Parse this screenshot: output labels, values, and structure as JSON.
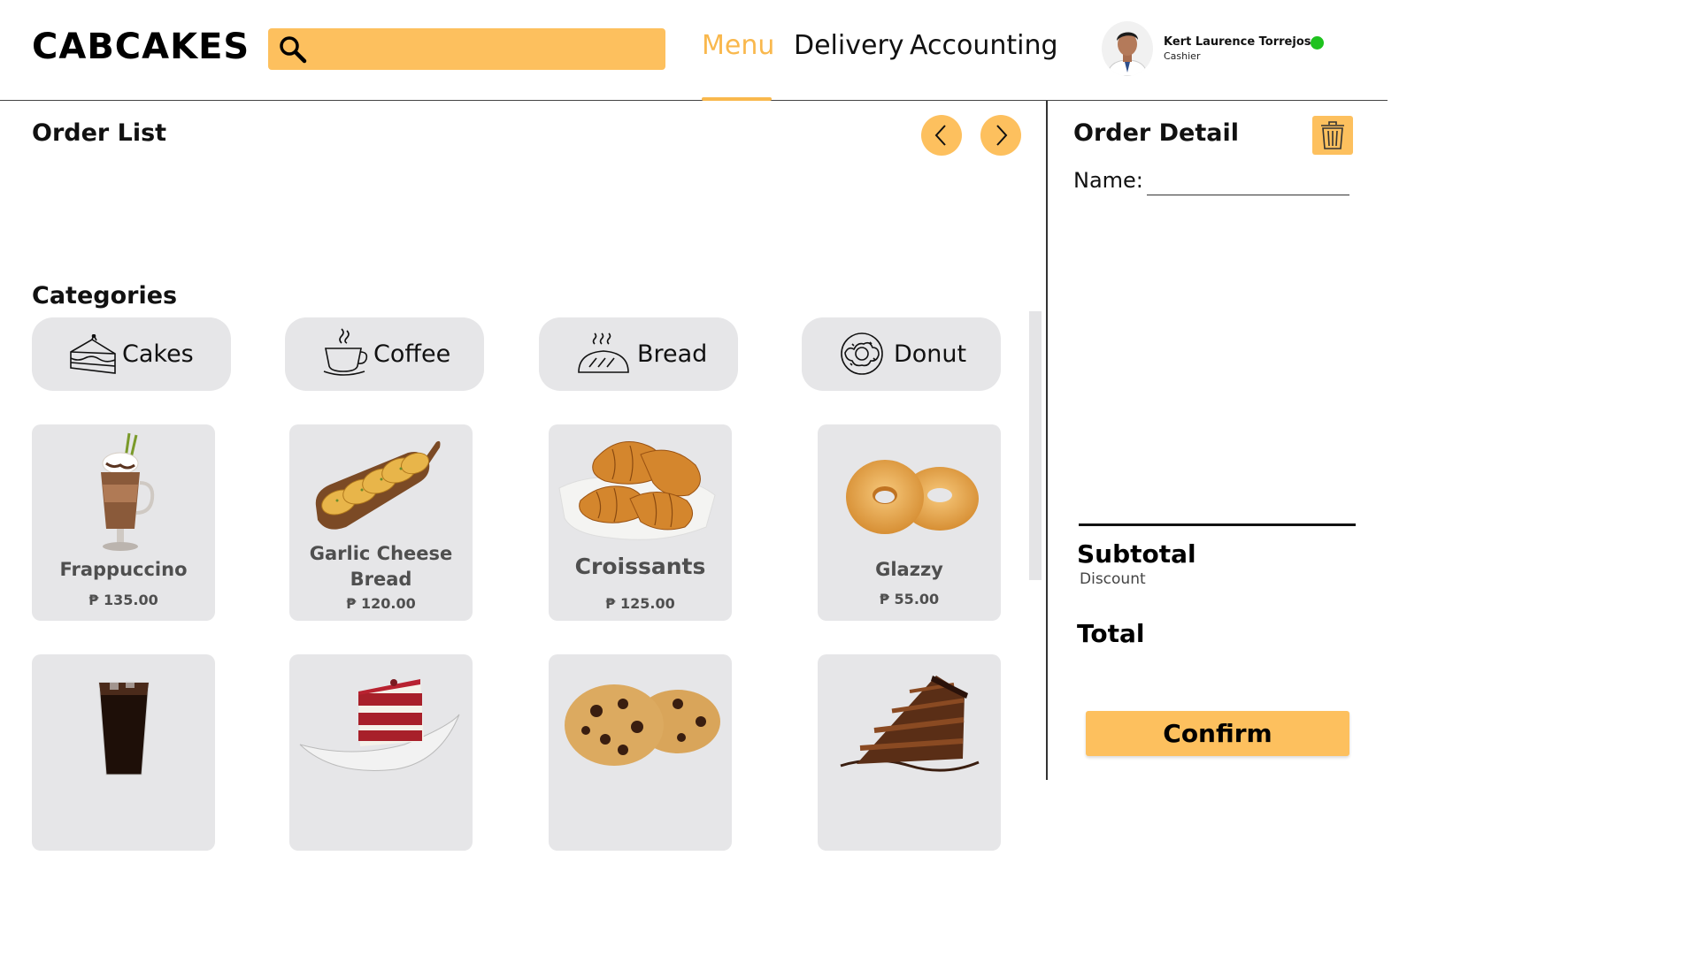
{
  "brand": {
    "logo": "CABCAKES"
  },
  "search": {
    "placeholder": "",
    "value": ""
  },
  "nav": {
    "items": [
      {
        "label": "Menu",
        "active": true
      },
      {
        "label": "Delivery"
      },
      {
        "label": "Accounting"
      }
    ]
  },
  "user": {
    "name": "Kert Laurence Torrejos",
    "role": "Cashier",
    "status_color": "#1ec21e"
  },
  "order_list": {
    "title": "Order List"
  },
  "categories": {
    "title": "Categories",
    "items": [
      {
        "label": "Cakes",
        "icon": "cake-icon"
      },
      {
        "label": "Coffee",
        "icon": "coffee-cup-icon"
      },
      {
        "label": "Bread",
        "icon": "bread-icon"
      },
      {
        "label": "Donut",
        "icon": "donut-icon"
      }
    ]
  },
  "products": [
    {
      "name": "Frappuccino",
      "price": "₱ 135.00",
      "image": "frappuccino-image"
    },
    {
      "name": "Garlic Cheese Bread",
      "price": "₱ 120.00",
      "image": "garlic-bread-image"
    },
    {
      "name": "Croissants",
      "price": "₱ 125.00",
      "image": "croissant-image"
    },
    {
      "name": "Glazzy",
      "price": "₱ 55.00",
      "image": "glazed-donut-image"
    },
    {
      "name": "",
      "price": "",
      "image": "iced-coffee-image"
    },
    {
      "name": "",
      "price": "",
      "image": "red-velvet-cake-image"
    },
    {
      "name": "",
      "price": "",
      "image": "chocolate-chip-cookies-image"
    },
    {
      "name": "",
      "price": "",
      "image": "chocolate-cake-image"
    }
  ],
  "order_detail": {
    "title": "Order Detail",
    "name_label": "Name:",
    "name_value": "",
    "subtotal_label": "Subtotal",
    "discount_label": "Discount",
    "total_label": "Total",
    "confirm_label": "Confirm"
  },
  "colors": {
    "accent": "#fdc05e",
    "active_nav": "#f9b84d",
    "card_bg": "#e6e6e8"
  }
}
